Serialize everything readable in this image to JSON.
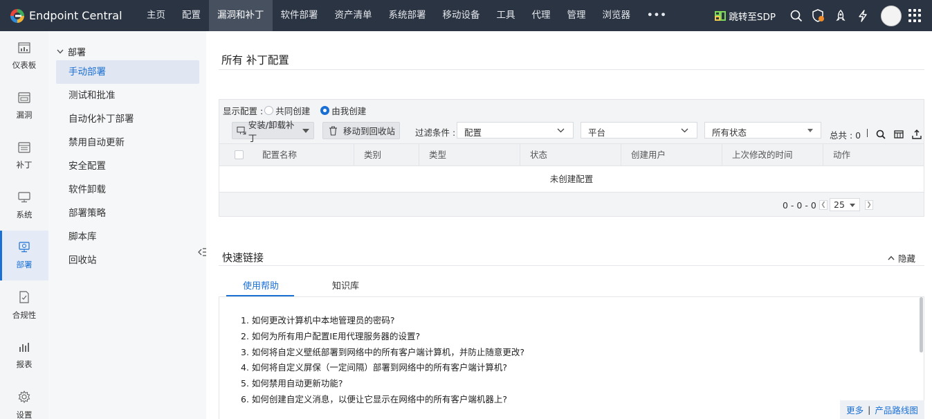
{
  "app": {
    "title": "Endpoint Central"
  },
  "topnav": {
    "items": [
      "主页",
      "配置",
      "漏洞和补丁",
      "软件部署",
      "资产清单",
      "系统部署",
      "移动设备",
      "工具",
      "代理",
      "管理",
      "浏览器"
    ],
    "active_index": 2,
    "more": "•••",
    "sdp_label": "跳转至SDP"
  },
  "rail": {
    "items": [
      {
        "label": "仪表板",
        "icon": "dashboard-icon"
      },
      {
        "label": "漏洞",
        "icon": "vulnerability-icon"
      },
      {
        "label": "补丁",
        "icon": "patch-icon"
      },
      {
        "label": "系统",
        "icon": "system-icon"
      },
      {
        "label": "部署",
        "icon": "deploy-icon",
        "active": true
      },
      {
        "label": "合规性",
        "icon": "compliance-icon"
      },
      {
        "label": "报表",
        "icon": "reports-icon"
      },
      {
        "label": "设置",
        "icon": "settings-icon"
      }
    ]
  },
  "submenu": {
    "heading": "部署",
    "items": [
      "手动部署",
      "测试和批准",
      "自动化补丁部署",
      "禁用自动更新",
      "安全配置",
      "软件卸载",
      "部署策略",
      "脚本库",
      "回收站"
    ],
    "active_index": 0
  },
  "main": {
    "title": "所有 补丁配置",
    "show_label": "显示配置 :",
    "radio_shared": "共同创建",
    "radio_mine": "由我创建",
    "btn_install": "安装/卸载补丁",
    "btn_recycle": "移动到回收站",
    "filter_label": "过滤条件 :",
    "filter_config": "配置",
    "filter_platform": "平台",
    "filter_status": "所有状态",
    "total": "总共 : 0",
    "columns": [
      "配置名称",
      "类别",
      "类型",
      "状态",
      "创建用户",
      "上次修改的时间",
      "动作"
    ],
    "empty_text": "未创建配置",
    "pager_range": "0 - 0 - 0",
    "page_size": "25"
  },
  "quick_links": {
    "title": "快速链接",
    "hide_label": "隐藏",
    "tabs": [
      "使用帮助",
      "知识库"
    ],
    "active_tab": 0,
    "help_items": [
      "1. 如何更改计算机中本地管理员的密码?",
      "2. 如何为所有用户配置IE用代理服务器的设置?",
      "3. 如何将自定义壁纸部署到网络中的所有客户端计算机，并防止随意更改?",
      "4. 如何将自定义屏保（一定间隔）部署到网络中的所有客户端计算机?",
      "5. 如何禁用自动更新功能?",
      "6. 如何创建自定义消息，以便让它显示在网络中的所有客户端机器上?"
    ],
    "more_label": "更多",
    "roadmap_label": "产品路线图"
  },
  "colors": {
    "topbar": "#2b3442",
    "accent": "#1a6fd3",
    "rail_bg": "#f4f5f7",
    "sdp_icon": "#7ed957"
  }
}
